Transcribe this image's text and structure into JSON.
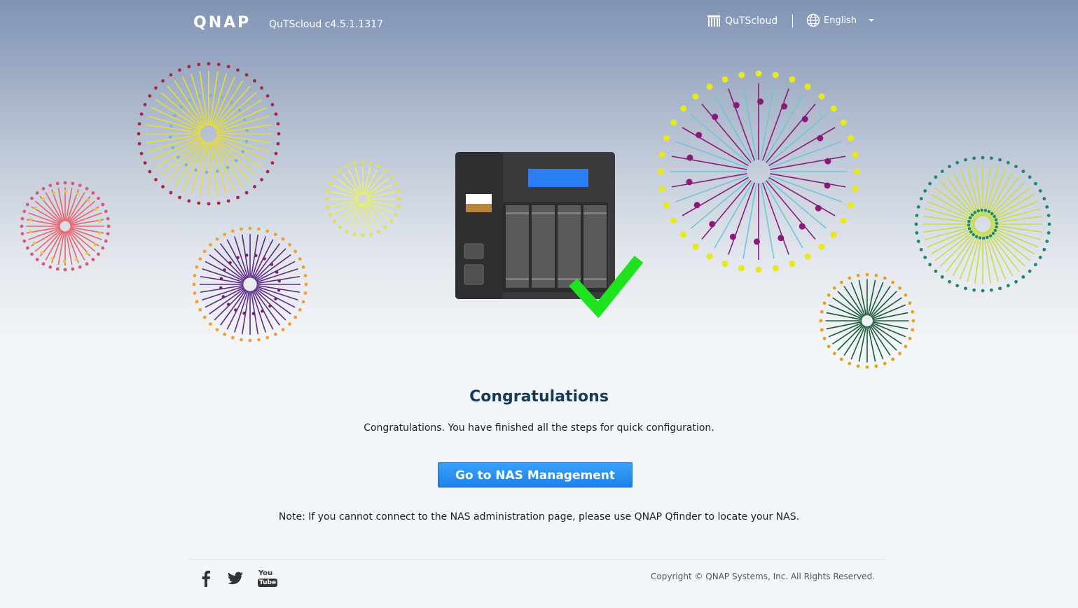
{
  "header": {
    "logo_text": "QNAP",
    "version": "QuTScloud c4.5.1.1317",
    "qutscloud_label": "QuTScloud",
    "language": "English"
  },
  "main": {
    "title": "Congratulations",
    "subtitle": "Congratulations. You have finished all the steps for quick configuration.",
    "button_label": "Go to NAS Management",
    "note": "Note: If you cannot connect to the NAS administration page, please use QNAP Qfinder to locate your NAS."
  },
  "footer": {
    "social": [
      "facebook-icon",
      "twitter-icon",
      "youtube-icon"
    ],
    "youtube_text_top": "You",
    "youtube_text_bottom": "Tube",
    "copyright": "Copyright © QNAP Systems, Inc. All Rights Reserved."
  },
  "colors": {
    "accent": "#2b93f2",
    "title": "#153a5c",
    "check": "#1ee31e",
    "nas_screen": "#2a7df5"
  }
}
